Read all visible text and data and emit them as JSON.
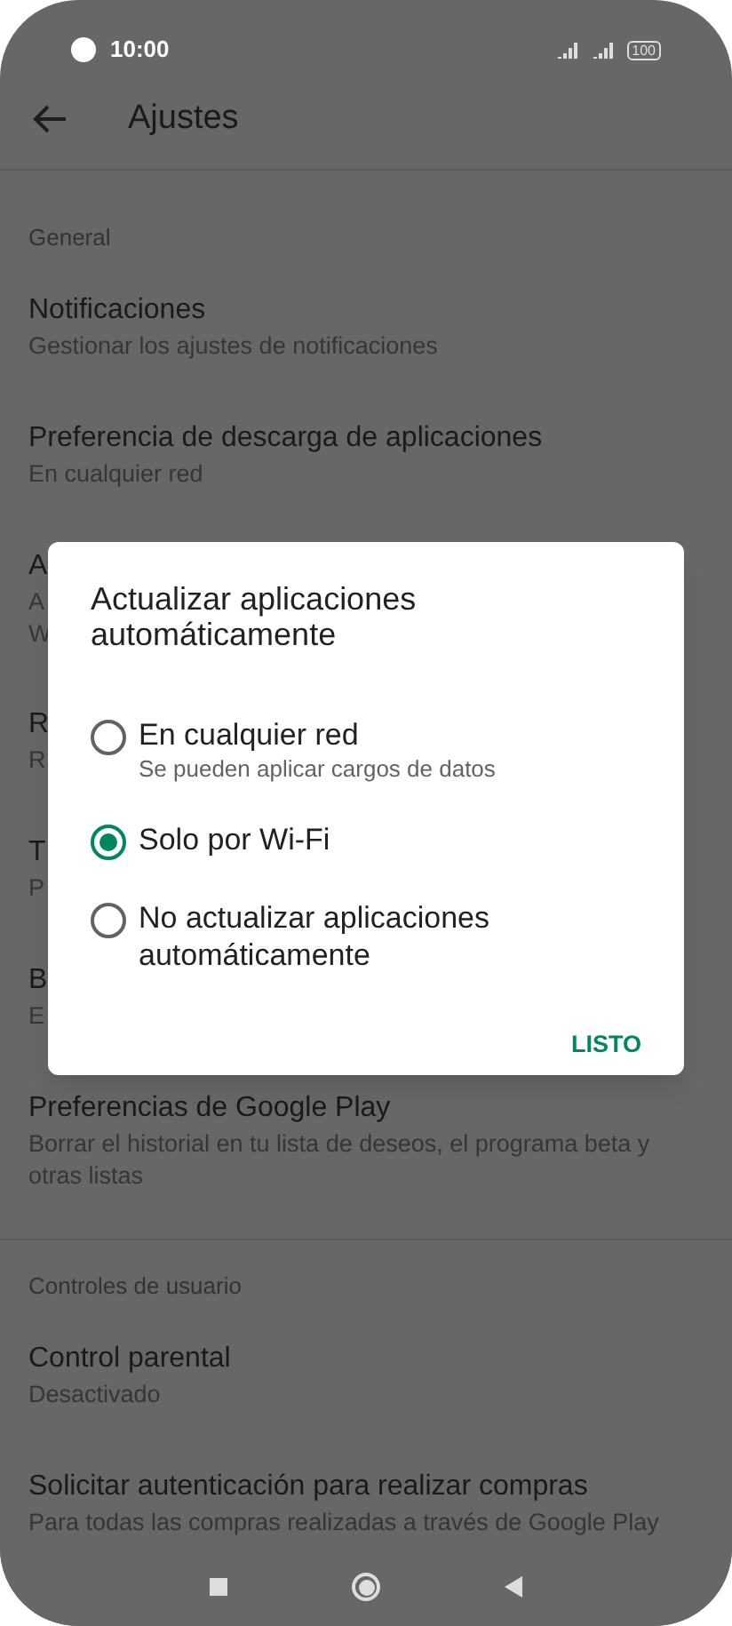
{
  "status_bar": {
    "time": "10:00",
    "battery": "100"
  },
  "toolbar": {
    "title": "Ajustes"
  },
  "sections": [
    {
      "header": "General",
      "items": [
        {
          "title": "Notificaciones",
          "subtitle": [
            "Gestionar los ajustes de notificaciones"
          ]
        },
        {
          "title": "Preferencia de descarga de aplicaciones",
          "subtitle": [
            "En cualquier red"
          ]
        },
        {
          "title": "A",
          "subtitle": [
            "A",
            "W"
          ]
        },
        {
          "title": "R",
          "subtitle": [
            "R"
          ]
        },
        {
          "title": "T",
          "subtitle": [
            "P"
          ]
        },
        {
          "title": "B",
          "subtitle": [
            "E"
          ]
        },
        {
          "title": "Preferencias de Google Play",
          "subtitle": [
            "Borrar el historial en tu lista de deseos, el programa beta y",
            "otras listas"
          ]
        }
      ]
    },
    {
      "header": "Controles de usuario",
      "items": [
        {
          "title": "Control parental",
          "subtitle": [
            "Desactivado"
          ]
        },
        {
          "title": "Solicitar autenticación para realizar compras",
          "subtitle": [
            "Para todas las compras realizadas a través de Google Play"
          ]
        }
      ]
    }
  ],
  "dialog": {
    "title": "Actualizar aplicaciones automáticamente",
    "options": [
      {
        "label": "En cualquier red",
        "hint": "Se pueden aplicar cargos de datos",
        "selected": false
      },
      {
        "label": "Solo por Wi-Fi",
        "selected": true
      },
      {
        "label": "No actualizar aplicaciones automáticamente",
        "selected": false
      }
    ],
    "button": "LISTO"
  }
}
